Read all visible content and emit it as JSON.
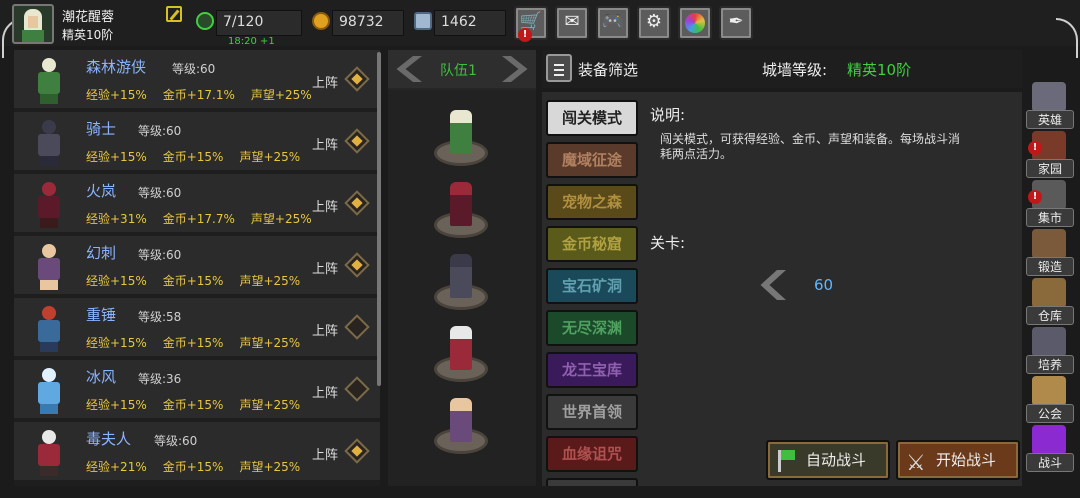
{
  "player": {
    "name": "潮花醒蓉",
    "rank": "精英10阶"
  },
  "stats": {
    "energy": "7/120",
    "gold": "98732",
    "gems": "1462",
    "timer": "18:20 +1"
  },
  "topbar": {
    "shop_icon": "cart-icon",
    "mail_icon": "mail-icon",
    "gamepad_icon": "gamepad-icon",
    "settings_icon": "gear-icon",
    "color_icon": "color-wheel-icon",
    "feather_icon": "feather-icon"
  },
  "heroes": [
    {
      "name": "森林游侠",
      "level": "等级:60",
      "exp": "经验+15%",
      "gold": "金币+17.1%",
      "fame": "声望+25%",
      "deploy": "上阵",
      "active": true,
      "colors": [
        "#e8e8d0",
        "#3f7f3f",
        "#2f5f2f"
      ]
    },
    {
      "name": "骑士",
      "level": "等级:60",
      "exp": "经验+15%",
      "gold": "金币+15%",
      "fame": "声望+25%",
      "deploy": "上阵",
      "active": true,
      "colors": [
        "#3a3a4a",
        "#4a4a5a",
        "#2a2a3a"
      ]
    },
    {
      "name": "火岚",
      "level": "等级:60",
      "exp": "经验+31%",
      "gold": "金币+17.7%",
      "fame": "声望+25%",
      "deploy": "上阵",
      "active": true,
      "colors": [
        "#9a2a3a",
        "#5a1a2a",
        "#3a1a1a"
      ]
    },
    {
      "name": "幻刺",
      "level": "等级:60",
      "exp": "经验+15%",
      "gold": "金币+15%",
      "fame": "声望+25%",
      "deploy": "上阵",
      "active": true,
      "colors": [
        "#e8c6a0",
        "#6a4a7a",
        "#e8c6a0"
      ]
    },
    {
      "name": "重锤",
      "level": "等级:58",
      "exp": "经验+15%",
      "gold": "金币+15%",
      "fame": "声望+25%",
      "deploy": "上阵",
      "active": false,
      "colors": [
        "#c04030",
        "#3a6a9a",
        "#2a3a5a"
      ]
    },
    {
      "name": "冰风",
      "level": "等级:36",
      "exp": "经验+15%",
      "gold": "金币+15%",
      "fame": "声望+25%",
      "deploy": "上阵",
      "active": false,
      "colors": [
        "#e0f0ff",
        "#5fa8e0",
        "#3a7ab0"
      ]
    },
    {
      "name": "毒夫人",
      "level": "等级:60",
      "exp": "经验+21%",
      "gold": "金币+15%",
      "fame": "声望+25%",
      "deploy": "上阵",
      "active": true,
      "colors": [
        "#e8e8e8",
        "#9a2a3a",
        "#3a2a2a"
      ]
    }
  ],
  "team": {
    "title": "队伍1",
    "slots": [
      [
        "#e8e8d0",
        "#3f7f3f"
      ],
      [
        "#9a2a3a",
        "#5a1a2a"
      ],
      [
        "#3a3a4a",
        "#4a4a5a"
      ],
      [
        "#e8e8e8",
        "#9a2a3a"
      ],
      [
        "#e8c6a0",
        "#6a4a7a"
      ]
    ]
  },
  "filter": {
    "label": "装备筛选",
    "wall_label": "城墙等级:",
    "wall_value": "精英10阶"
  },
  "modes": [
    {
      "label": "闯关模式",
      "bg": "#d8d8d8",
      "fg": "#222"
    },
    {
      "label": "魔域征途",
      "bg": "#5a3a2a",
      "fg": "#b08060"
    },
    {
      "label": "宠物之森",
      "bg": "#5a4a1a",
      "fg": "#b09040"
    },
    {
      "label": "金币秘窟",
      "bg": "#5a5a1a",
      "fg": "#b0a040"
    },
    {
      "label": "宝石矿洞",
      "bg": "#1a4a5a",
      "fg": "#60a0b0"
    },
    {
      "label": "无尽深渊",
      "bg": "#1a4a2a",
      "fg": "#50a060"
    },
    {
      "label": "龙王宝库",
      "bg": "#3a1a5a",
      "fg": "#9060b0"
    },
    {
      "label": "世界首领",
      "bg": "#3a3a3a",
      "fg": "#a0a0a0"
    },
    {
      "label": "血缘诅咒",
      "bg": "#5a1a1a",
      "fg": "#b05050"
    }
  ],
  "description": {
    "title": "说明:",
    "body": "闯关模式，可获得经验、金币、声望和装备。每场战斗消耗两点活力。"
  },
  "stage": {
    "title": "关卡:",
    "value": "60"
  },
  "buttons": {
    "auto_battle": "自动战斗",
    "start_battle": "开始战斗"
  },
  "sidebar": [
    {
      "label": "英雄",
      "alert": false,
      "color": "#6a6a7a"
    },
    {
      "label": "家园",
      "alert": true,
      "color": "#7a3a2a"
    },
    {
      "label": "集市",
      "alert": true,
      "color": "#5a5a5a"
    },
    {
      "label": "锻造",
      "alert": false,
      "color": "#7a5a3a"
    },
    {
      "label": "仓库",
      "alert": false,
      "color": "#8a6a3a"
    },
    {
      "label": "培养",
      "alert": false,
      "color": "#5a5a6a"
    },
    {
      "label": "公会",
      "alert": false,
      "color": "#b08a4a"
    },
    {
      "label": "战斗",
      "alert": false,
      "color": "#8a2ad0"
    }
  ]
}
